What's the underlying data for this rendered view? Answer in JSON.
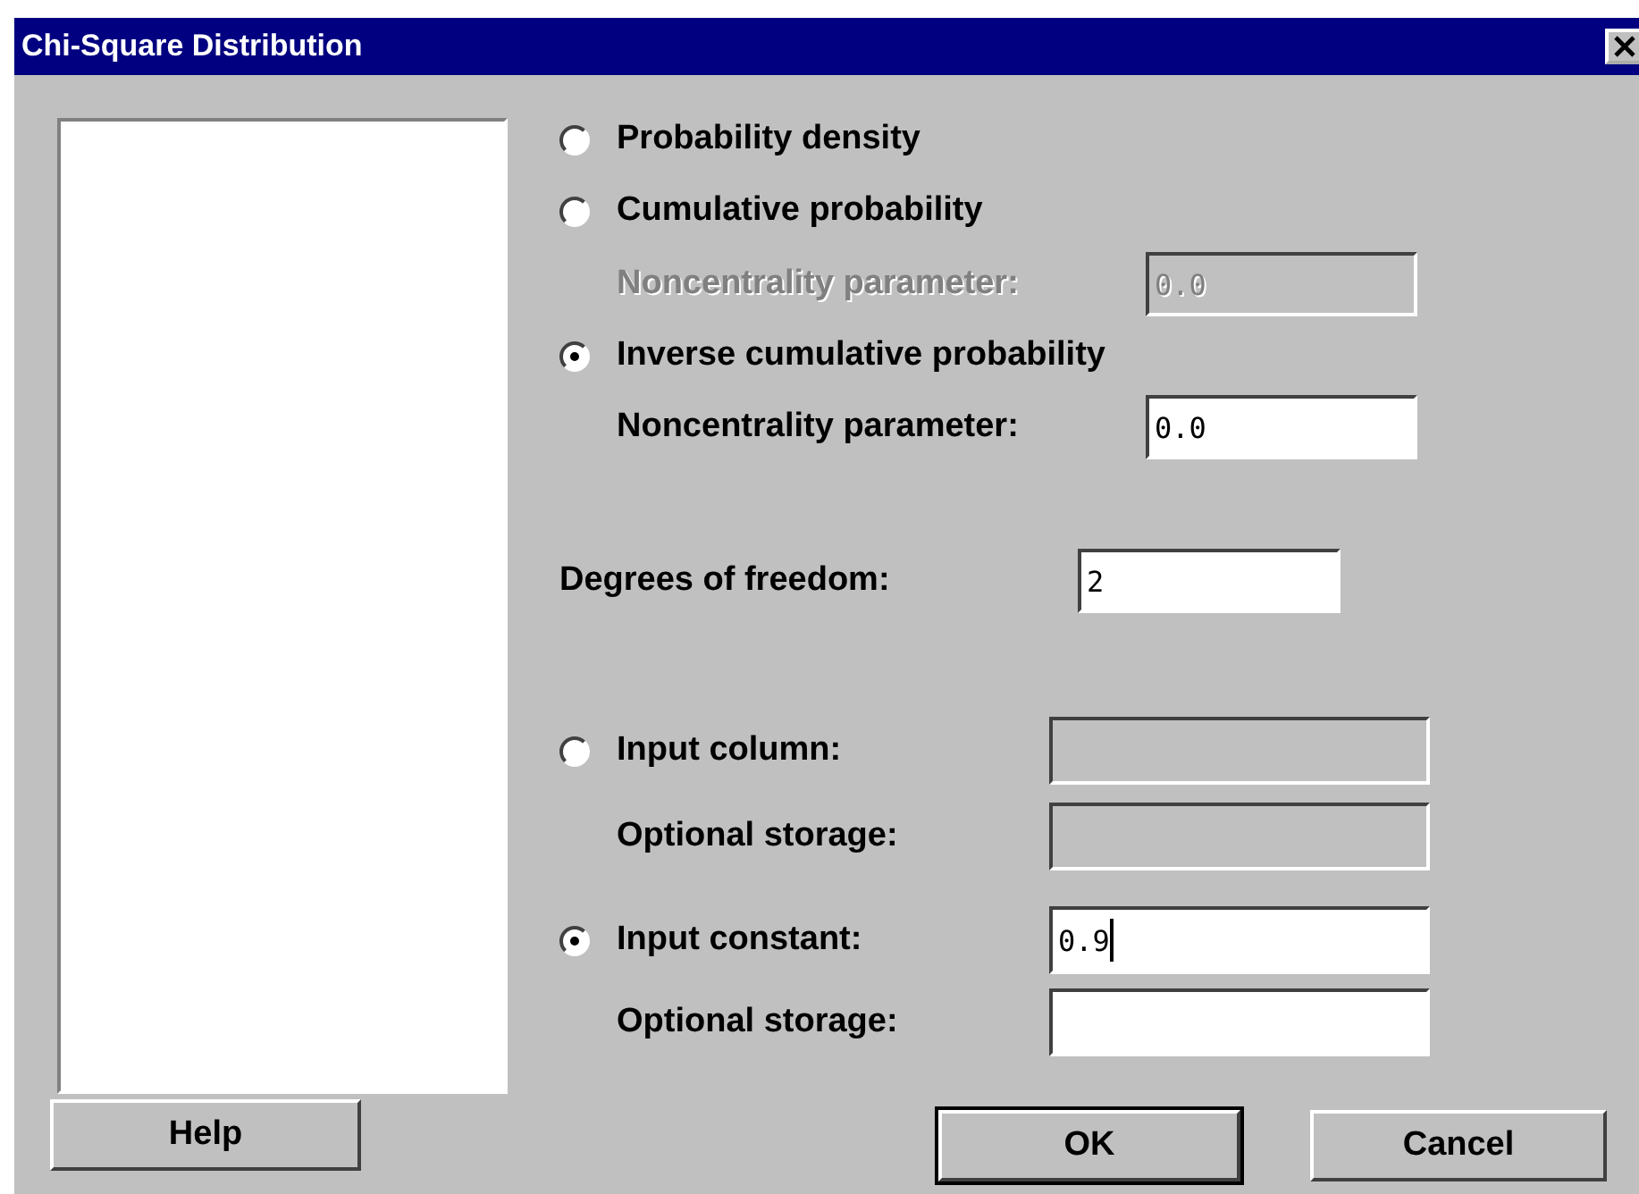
{
  "window": {
    "title": "Chi-Square Distribution"
  },
  "distribution_options": [
    {
      "label": "Probability density",
      "selected": false
    },
    {
      "label": "Cumulative probability",
      "selected": false,
      "noncentrality": {
        "label": "Noncentrality parameter:",
        "value": "0.0",
        "disabled": true
      }
    },
    {
      "label": "Inverse cumulative probability",
      "selected": true,
      "noncentrality": {
        "label": "Noncentrality parameter:",
        "value": "0.0",
        "disabled": false
      }
    }
  ],
  "degrees_of_freedom": {
    "label": "Degrees of freedom:",
    "value": "2"
  },
  "input_options": [
    {
      "label": "Input column:",
      "selected": false,
      "disabled": true,
      "storage": {
        "label": "Optional storage:",
        "disabled": true
      }
    },
    {
      "label": "Input constant:",
      "selected": true,
      "disabled": false,
      "value": "0.9",
      "focused": true,
      "storage": {
        "label": "Optional storage:",
        "disabled": false
      }
    }
  ],
  "buttons": {
    "help": {
      "label": "Help"
    },
    "ok": {
      "label": "OK",
      "default": true
    },
    "cancel": {
      "label": "Cancel",
      "default": false
    }
  }
}
